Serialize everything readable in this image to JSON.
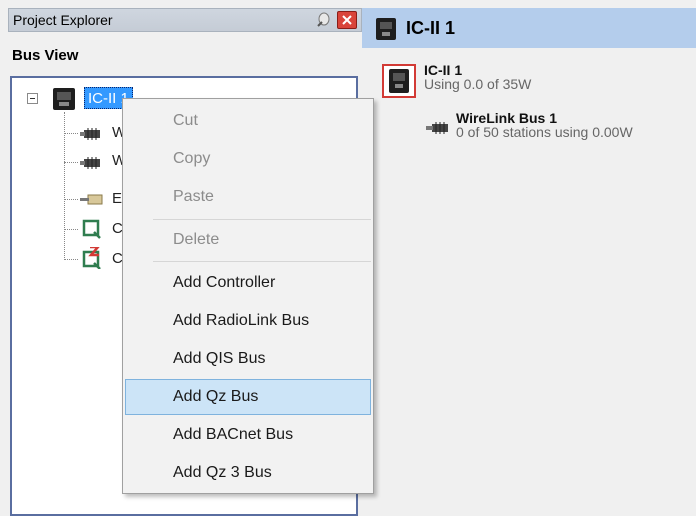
{
  "project_explorer": {
    "title": "Project Explorer",
    "bus_view_label": "Bus View",
    "tree": {
      "root_label": "IC-II 1",
      "children_visible_text": [
        "W",
        "W",
        "E",
        "C",
        "C"
      ]
    }
  },
  "context_menu": {
    "items": [
      {
        "label": "Cut",
        "enabled": false
      },
      {
        "label": "Copy",
        "enabled": false
      },
      {
        "label": "Paste",
        "enabled": false
      },
      {
        "label": "Delete",
        "enabled": false
      },
      {
        "label": "Add Controller",
        "enabled": true
      },
      {
        "label": "Add RadioLink Bus",
        "enabled": true
      },
      {
        "label": "Add QIS Bus",
        "enabled": true
      },
      {
        "label": "Add Qz Bus",
        "enabled": true,
        "highlighted": true
      },
      {
        "label": "Add BACnet Bus",
        "enabled": true
      },
      {
        "label": "Add Qz 3 Bus",
        "enabled": true
      }
    ]
  },
  "detail_panel": {
    "header_title": "IC-II 1",
    "controller": {
      "name": "IC-II 1",
      "usage": "Using 0.0 of 35W"
    },
    "bus": {
      "name": "WireLink Bus 1",
      "usage": "0 of 50 stations using 0.00W"
    }
  },
  "colors": {
    "selection": "#3399ff",
    "menu_highlight": "#cce4f7",
    "header_bg": "#b4cdec",
    "close_button": "#d9443a",
    "controller_border": "#d23a35"
  },
  "icons": [
    "pin-icon",
    "close-icon",
    "controller-icon",
    "wirelink-bus-icon",
    "ethernet-icon",
    "qz-bus-icon",
    "qz-bus-error-icon"
  ]
}
